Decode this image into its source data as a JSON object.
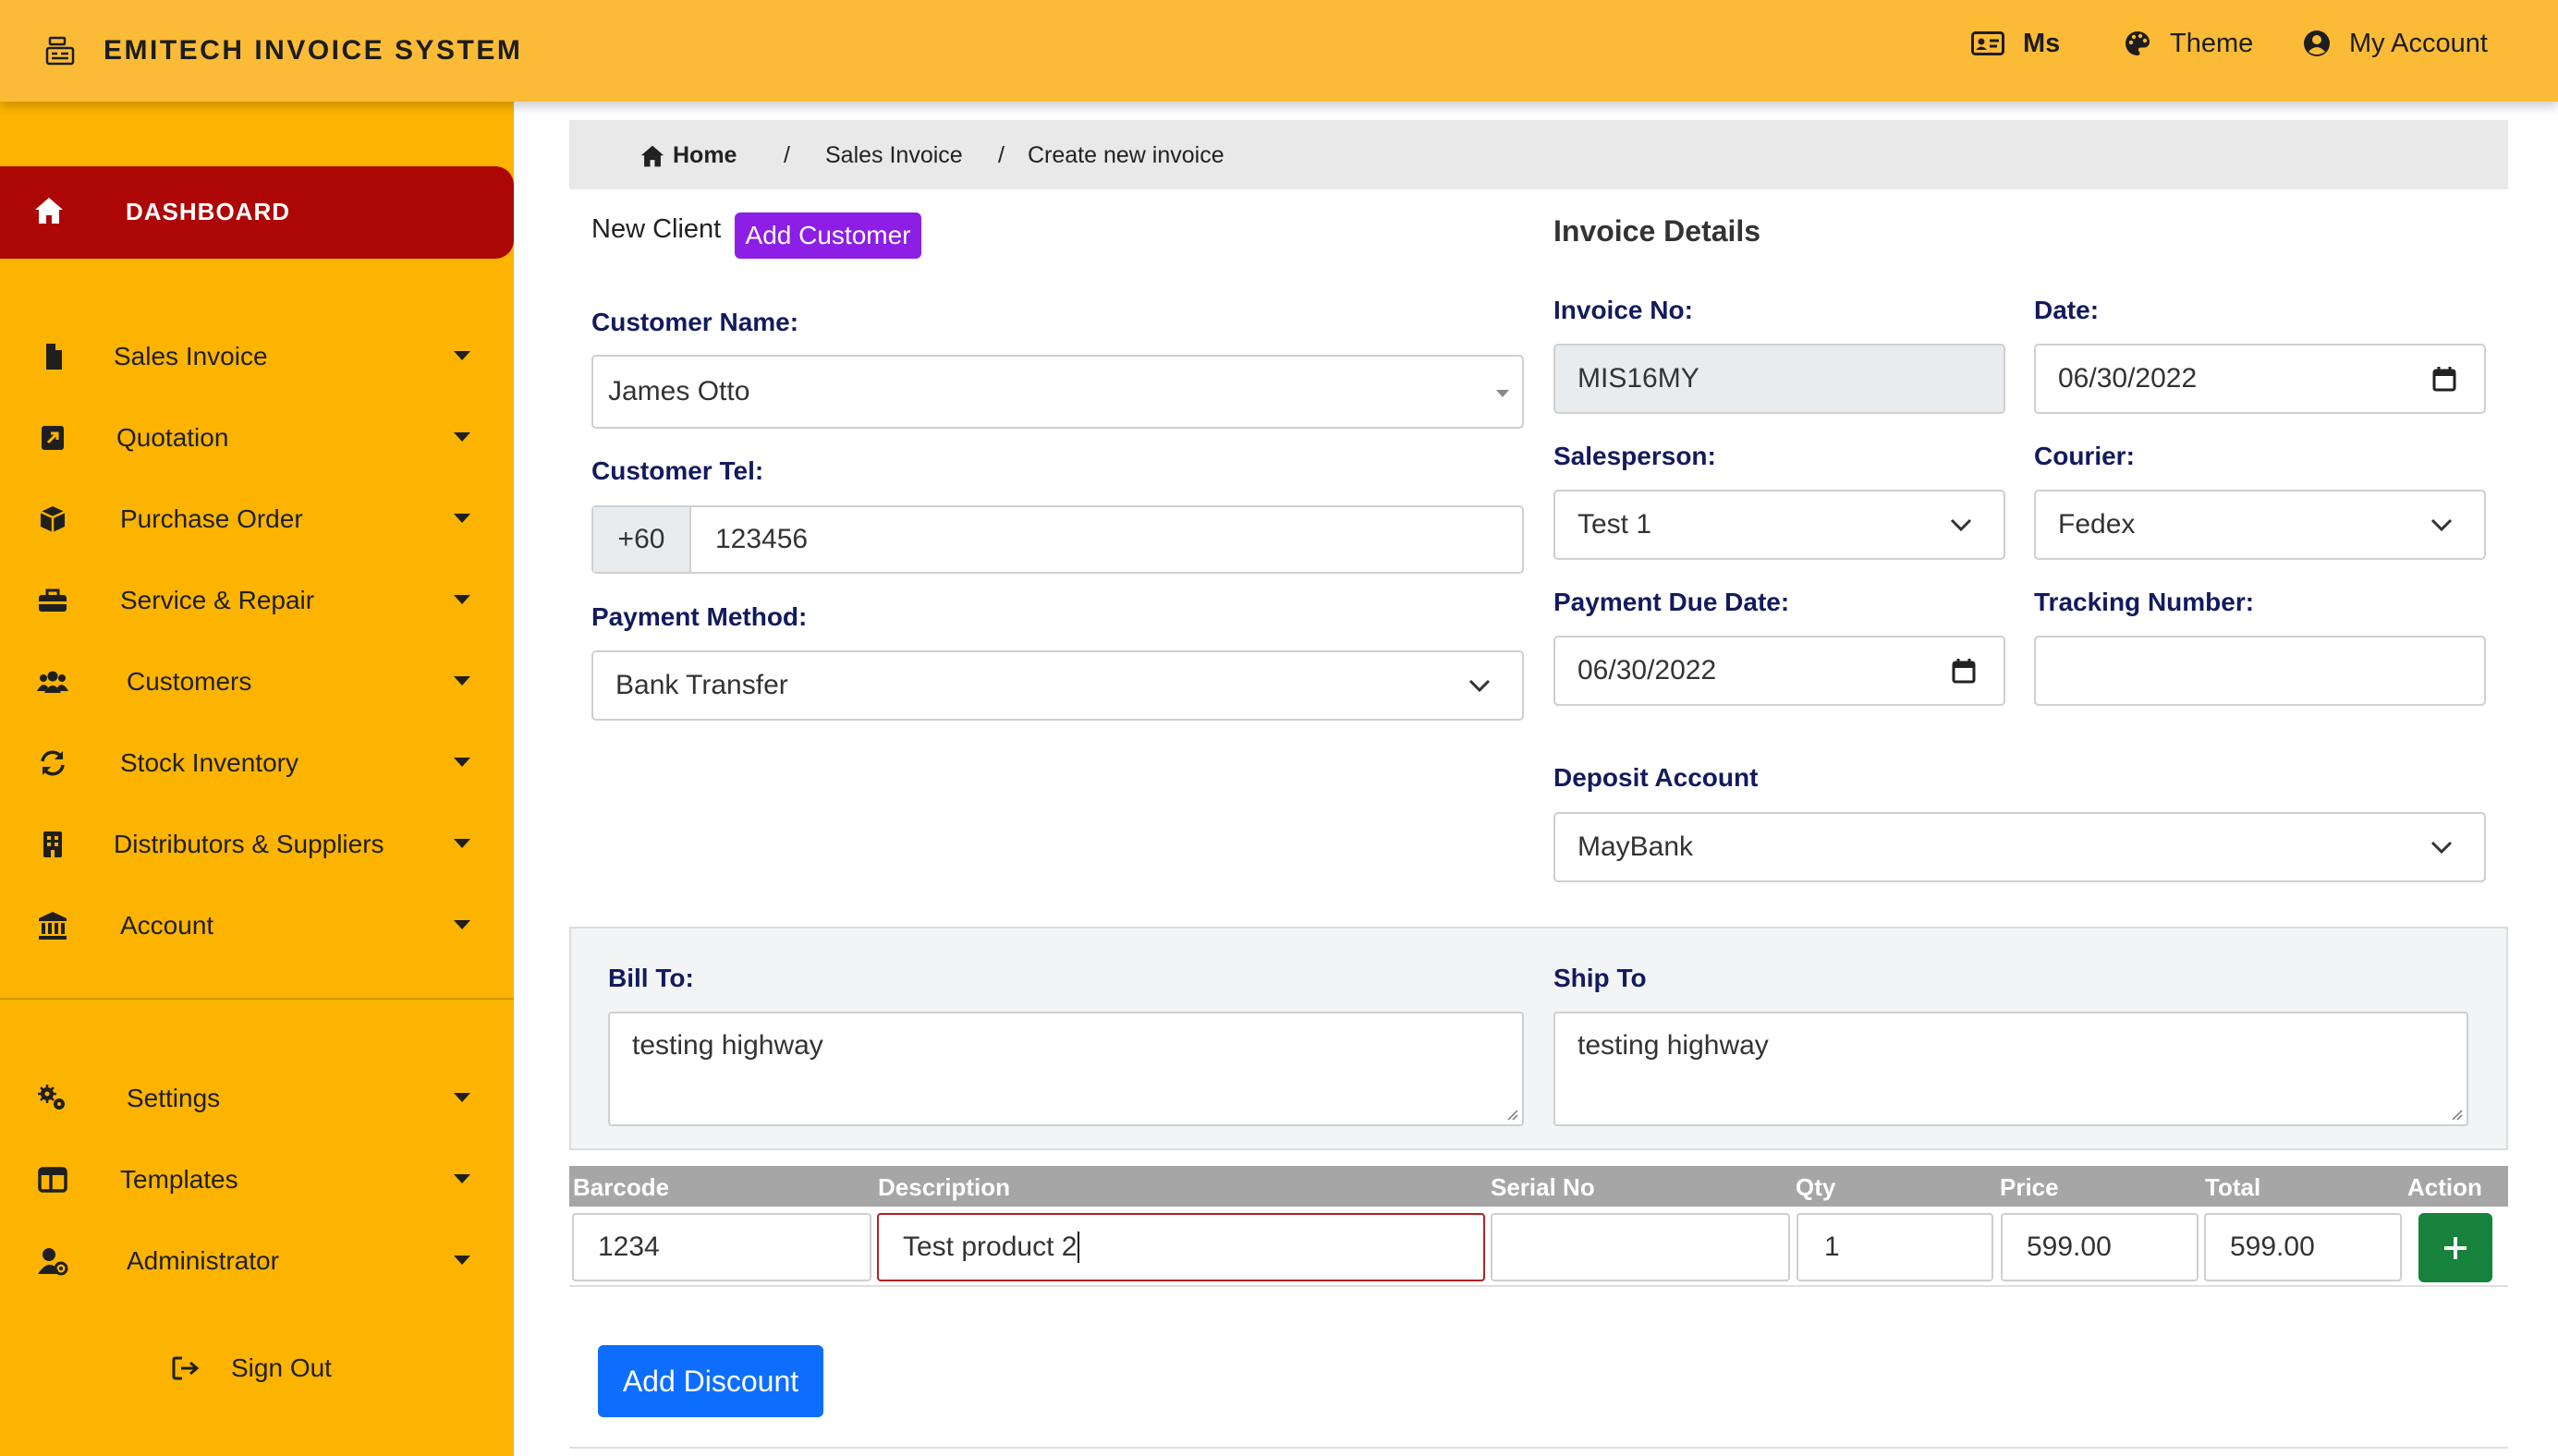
{
  "header": {
    "app_title": "EMITECH INVOICE SYSTEM",
    "user_short": "Ms",
    "theme_label": "Theme",
    "account_label": "My Account"
  },
  "sidebar": {
    "dashboard_label": "DASHBOARD",
    "items": [
      {
        "label": "Sales Invoice",
        "icon": "file-icon"
      },
      {
        "label": "Quotation",
        "icon": "quote-icon"
      },
      {
        "label": "Purchase Order",
        "icon": "box-icon"
      },
      {
        "label": "Service & Repair",
        "icon": "toolbox-icon"
      },
      {
        "label": "Customers",
        "icon": "users-icon"
      },
      {
        "label": "Stock Inventory",
        "icon": "sync-icon"
      },
      {
        "label": "Distributors & Suppliers",
        "icon": "building-icon"
      },
      {
        "label": "Account",
        "icon": "bank-icon"
      },
      {
        "label": "Settings",
        "icon": "gears-icon"
      },
      {
        "label": "Templates",
        "icon": "template-icon"
      },
      {
        "label": "Administrator",
        "icon": "user-cog-icon"
      }
    ],
    "sign_out_label": "Sign Out"
  },
  "breadcrumb": {
    "home": "Home",
    "separator": "/",
    "section": "Sales Invoice",
    "current": "Create new invoice"
  },
  "client": {
    "new_client_label": "New Client",
    "add_customer_label": "Add Customer",
    "customer_name_label": "Customer Name:",
    "customer_name_value": "James Otto",
    "customer_tel_label": "Customer Tel:",
    "tel_prefix": "+60",
    "tel_value": "123456",
    "payment_method_label": "Payment Method:",
    "payment_method_value": "Bank Transfer"
  },
  "invoice": {
    "title": "Invoice Details",
    "invoice_no_label": "Invoice No:",
    "invoice_no_value": "MIS16MY",
    "date_label": "Date:",
    "date_value": "06/30/2022",
    "salesperson_label": "Salesperson:",
    "salesperson_value": "Test 1",
    "courier_label": "Courier:",
    "courier_value": "Fedex",
    "payment_due_label": "Payment Due Date:",
    "payment_due_value": "06/30/2022",
    "tracking_label": "Tracking Number:",
    "tracking_value": "",
    "deposit_label": "Deposit Account",
    "deposit_value": "MayBank"
  },
  "address": {
    "bill_to_label": "Bill To:",
    "bill_to_value": "testing highway",
    "ship_to_label": "Ship To",
    "ship_to_value": "testing highway"
  },
  "items_table": {
    "headers": [
      "Barcode",
      "Description",
      "Serial No",
      "Qty",
      "Price",
      "Total",
      "Action"
    ],
    "rows": [
      {
        "barcode": "1234",
        "description": "Test product 2",
        "serial": "",
        "qty": "1",
        "price": "599.00",
        "total": "599.00"
      }
    ]
  },
  "actions": {
    "add_discount_label": "Add Discount"
  },
  "colors": {
    "topbar": "#fcbb37",
    "sidebar": "#fcb400",
    "dashboard_active": "#ad0607",
    "label_navy": "#131b5d",
    "add_customer": "#8d1ee6",
    "add_row_green": "#16823c",
    "primary_blue": "#0d6efd"
  }
}
